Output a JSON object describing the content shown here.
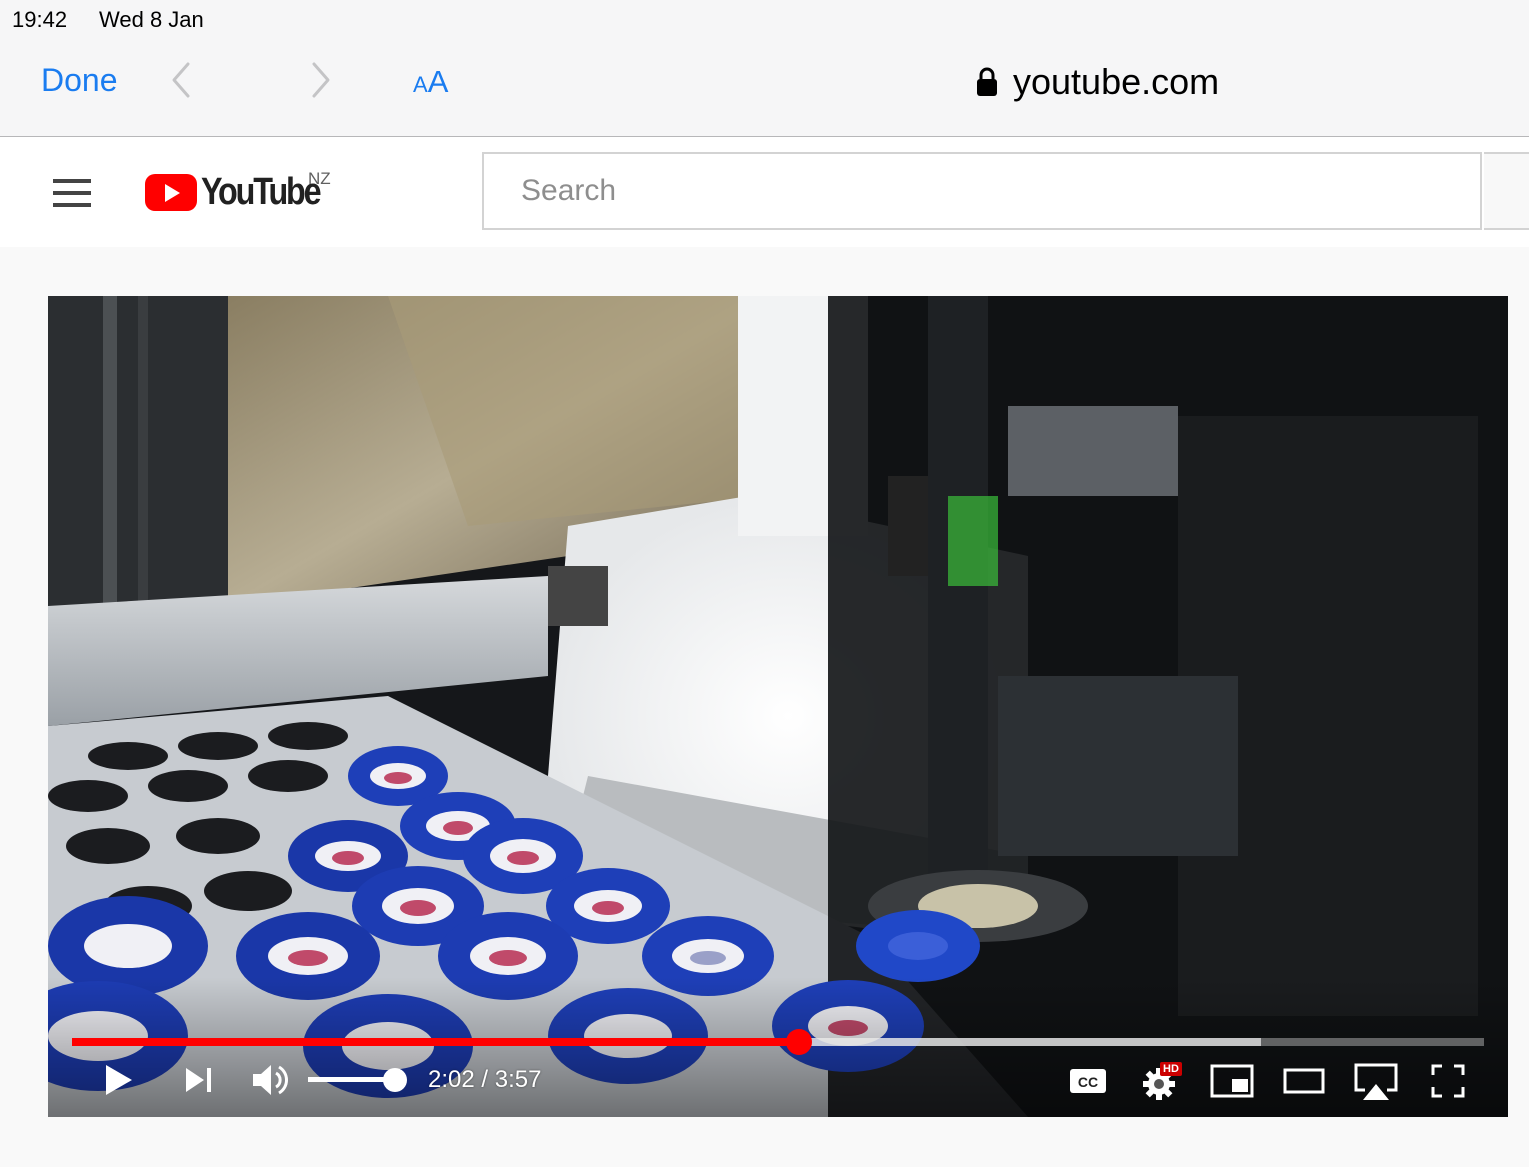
{
  "status_bar": {
    "time": "19:42",
    "date": "Wed 8 Jan"
  },
  "safari": {
    "done_label": "Done",
    "reader_small": "A",
    "reader_big": "A",
    "url": "youtube.com",
    "back_icon": "chevron-left-icon",
    "forward_icon": "chevron-right-icon",
    "lock_icon": "lock-icon"
  },
  "youtube": {
    "logo_text": "YouTube",
    "country_code": "NZ",
    "search_placeholder": "Search",
    "brand_color": "#ff0000"
  },
  "player": {
    "current_time": "2:02",
    "separator": " / ",
    "duration": "3:57",
    "progress_played_fraction": 0.515,
    "progress_buffered_fraction": 0.842,
    "volume_fraction": 0.95,
    "hd_badge": "HD",
    "icons": [
      "play-icon",
      "next-icon",
      "volume-icon",
      "captions-icon",
      "settings-icon",
      "miniplayer-icon",
      "theater-mode-icon",
      "airplay-icon",
      "fullscreen-icon"
    ]
  }
}
